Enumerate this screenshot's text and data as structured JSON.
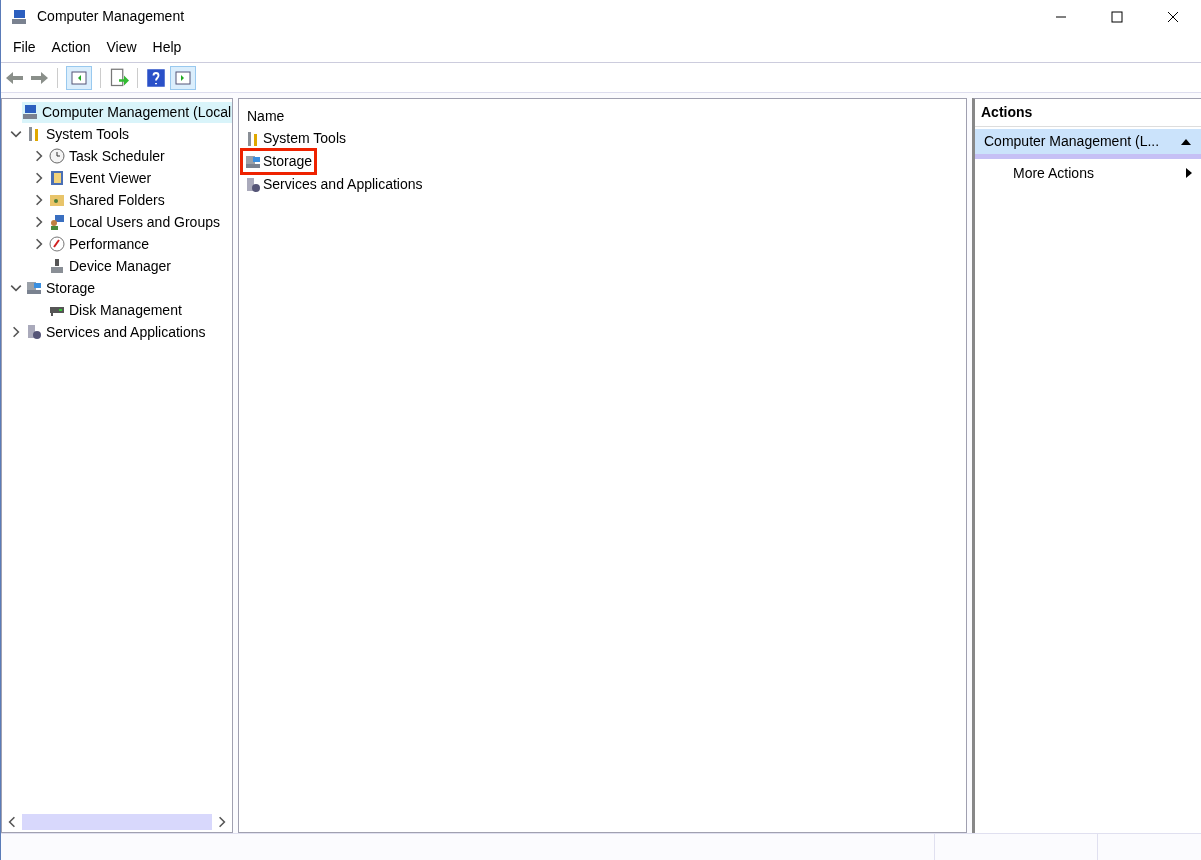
{
  "window": {
    "title": "Computer Management"
  },
  "menu": [
    "File",
    "Action",
    "View",
    "Help"
  ],
  "tree": [
    {
      "label": "Computer Management (Local",
      "selected": true,
      "children": [
        {
          "label": "System Tools",
          "selected": false,
          "expanded": true,
          "children": [
            {
              "label": "Task Scheduler",
              "selected": false,
              "expanded": false
            },
            {
              "label": "Event Viewer",
              "selected": false,
              "expanded": false
            },
            {
              "label": "Shared Folders",
              "selected": false,
              "expanded": false
            },
            {
              "label": "Local Users and Groups",
              "selected": false,
              "expanded": false
            },
            {
              "label": "Performance",
              "selected": false,
              "expanded": false
            },
            {
              "label": "Device Manager",
              "selected": false
            }
          ]
        },
        {
          "label": "Storage",
          "selected": false,
          "expanded": true,
          "children": [
            {
              "label": "Disk Management",
              "selected": false
            }
          ]
        },
        {
          "label": "Services and Applications",
          "selected": false,
          "expanded": false
        }
      ]
    }
  ],
  "list": {
    "column": "Name",
    "items": [
      {
        "label": "System Tools",
        "highlighted": false
      },
      {
        "label": "Storage",
        "highlighted": true
      },
      {
        "label": "Services and Applications",
        "highlighted": false
      }
    ]
  },
  "actions": {
    "title": "Actions",
    "group": "Computer Management (L...",
    "items": [
      "More Actions"
    ]
  }
}
